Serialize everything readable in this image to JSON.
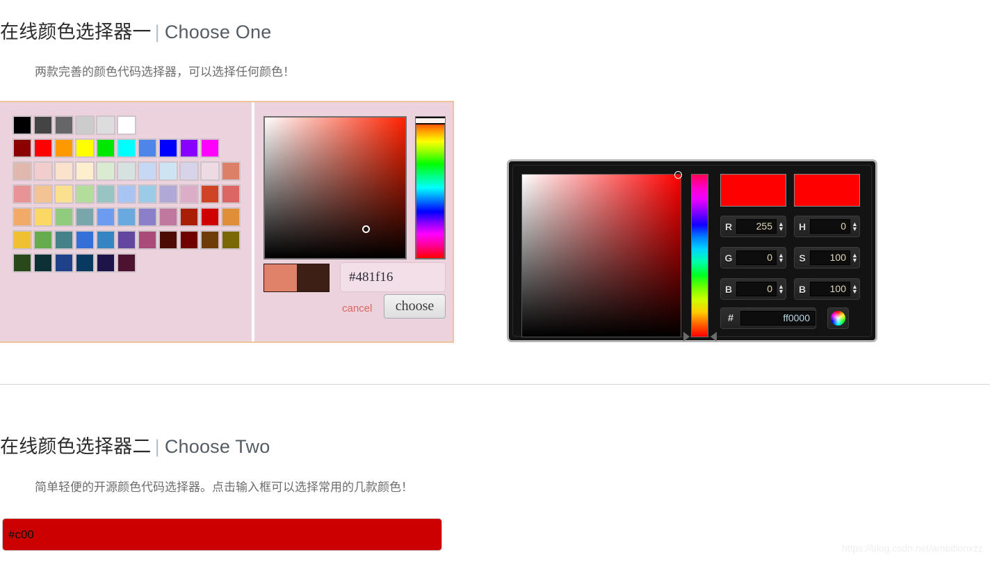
{
  "sections": [
    {
      "title_cn": "在线颜色选择器一",
      "separator": "|",
      "title_en": "Choose One",
      "description": "两款完善的颜色代码选择器，可以选择任何颜色！"
    },
    {
      "title_cn": "在线颜色选择器二",
      "separator": "|",
      "title_en": "Choose Two",
      "description": "简单轻便的开源颜色代码选择器。点击输入框可以选择常用的几款颜色！"
    }
  ],
  "picker_one": {
    "panel_bg": "#ecd2dd",
    "panel_border": "#f0c49a",
    "hex_value": "#481f16",
    "hex_placeholder": "#000000",
    "cancel_label": "cancel",
    "choose_label": "choose",
    "preview_new": "#e0826a",
    "preview_old": "#3d1f16",
    "swatch_rows": [
      [
        "#000000",
        "#444444",
        "#666666",
        "#cccccc",
        "#dddddd",
        "#ffffff"
      ],
      [
        "#8b0000",
        "#ff0000",
        "#ff9900",
        "#ffff00",
        "#00e800",
        "#00ffff",
        "#4d86e8",
        "#0000ff",
        "#8800ff",
        "#ff00ff"
      ],
      [
        "#e0b8ae",
        "#f2cdcd",
        "#fae2cd",
        "#fdeecd",
        "#d9ecd2",
        "#d5e2e0",
        "#c6d8f4",
        "#cfe4f2",
        "#d7d4ea",
        "#eedae3",
        "#dd8068"
      ],
      [
        "#e89395",
        "#f3c393",
        "#fbe08f",
        "#b3dd9b",
        "#99c4c4",
        "#a7c4f2",
        "#9ccbe8",
        "#b0a9d8",
        "#dbadc6",
        "#cf4424",
        "#db6663"
      ],
      [
        "#f2aa68",
        "#fbd863",
        "#90cb7e",
        "#78a6ab",
        "#6d9bf0",
        "#6aa9dd",
        "#8a7fc8",
        "#c0789f",
        "#a91f05",
        "#cf0000",
        "#e08f38"
      ],
      [
        "#eec032",
        "#66ab4d",
        "#448189",
        "#3570d9",
        "#3784c2",
        "#63479f",
        "#a94a78",
        "#4d0c03",
        "#700000",
        "#6e3c06",
        "#7a6806"
      ],
      [
        "#29491a",
        "#0d3036",
        "#1e4189",
        "#073961",
        "#1e1449",
        "#4c1230"
      ]
    ]
  },
  "picker_two": {
    "frame_border": "#b4b4b4",
    "background": "#141414",
    "preview_new": "#ff0000",
    "preview_old": "#ff0000",
    "fields": [
      {
        "label": "R",
        "value": "255"
      },
      {
        "label": "H",
        "value": "0"
      },
      {
        "label": "G",
        "value": "0"
      },
      {
        "label": "S",
        "value": "100"
      },
      {
        "label": "B",
        "value": "0"
      },
      {
        "label": "B",
        "value": "100"
      }
    ],
    "hex_label": "#",
    "hex_value": "ff0000",
    "wheel_icon": "color-wheel-icon"
  },
  "simple_picker": {
    "value": "#c00",
    "placeholder": "#000000",
    "background": "#cc0000"
  },
  "watermark": "https://blog.csdn.net/ambitionxzz"
}
